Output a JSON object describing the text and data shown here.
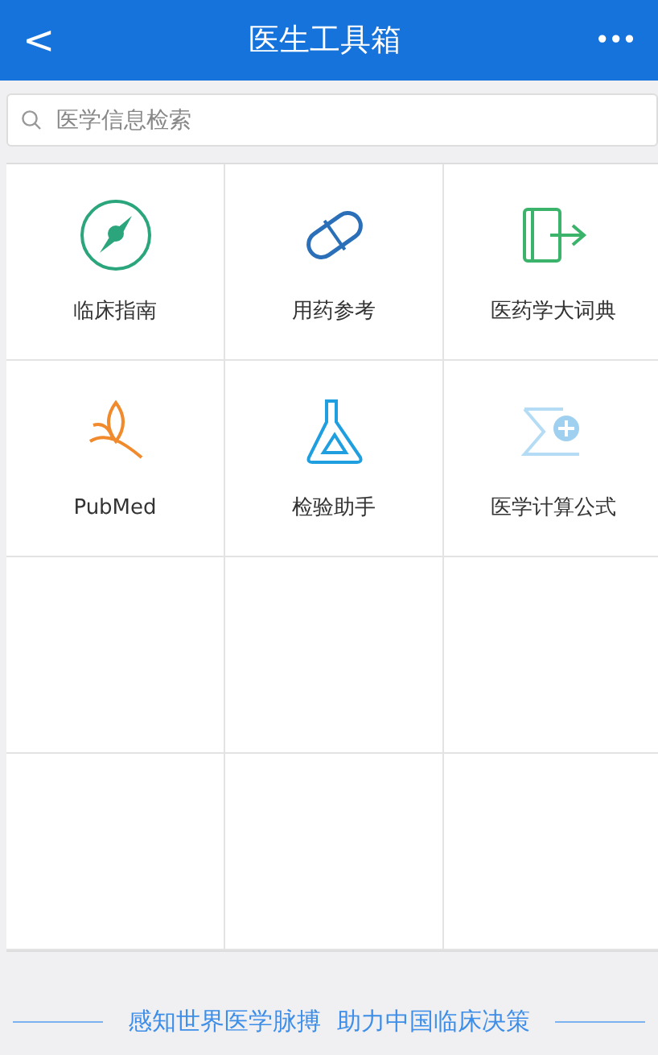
{
  "header": {
    "back": "<",
    "title": "医生工具箱",
    "more": "•••"
  },
  "search": {
    "placeholder": "医学信息检索"
  },
  "tools": [
    {
      "label": "临床指南",
      "kind": "compass"
    },
    {
      "label": "用药参考",
      "kind": "capsule"
    },
    {
      "label": "医药学大词典",
      "kind": "book"
    },
    {
      "label": "PubMed",
      "kind": "leaf"
    },
    {
      "label": "检验助手",
      "kind": "flask"
    },
    {
      "label": "医学计算公式",
      "kind": "calc"
    }
  ],
  "slogan": [
    "感知世界医学脉搏",
    "助力中国临床决策"
  ]
}
